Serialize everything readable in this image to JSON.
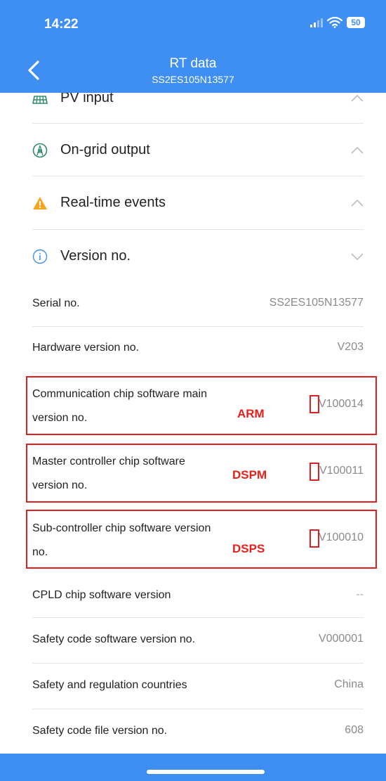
{
  "status_bar": {
    "time": "14:22",
    "battery": "50"
  },
  "nav": {
    "title": "RT data",
    "subtitle": "SS2ES105N13577"
  },
  "sections": [
    {
      "label": "PV input",
      "icon": "solar-panel-icon"
    },
    {
      "label": "On-grid output",
      "icon": "grid-tower-icon"
    },
    {
      "label": "Real-time events",
      "icon": "warning-icon"
    },
    {
      "label": "Version no.",
      "icon": "info-icon"
    }
  ],
  "rows": [
    {
      "label": "Serial no.",
      "value": "SS2ES105N13577"
    },
    {
      "label": "Hardware version no.",
      "value": "V203"
    },
    {
      "label_line1": "Communication chip software main",
      "label_line2": "version no.",
      "value": "V100014",
      "annotation": "ARM"
    },
    {
      "label_line1": "Master controller chip software",
      "label_line2": "version no.",
      "value": "V100011",
      "annotation": "DSPM"
    },
    {
      "label_line1": "Sub-controller chip software version",
      "label_line2": "no.",
      "value": "V100010",
      "annotation": "DSPS"
    },
    {
      "label": "CPLD chip software version",
      "value": "--"
    },
    {
      "label": "Safety code software version no.",
      "value": "V000001"
    },
    {
      "label": "Safety and regulation countries",
      "value": "China"
    },
    {
      "label": "Safety code file version no.",
      "value": "608"
    }
  ],
  "colors": {
    "header": "#3f8ff2",
    "annotation": "#e02020"
  }
}
